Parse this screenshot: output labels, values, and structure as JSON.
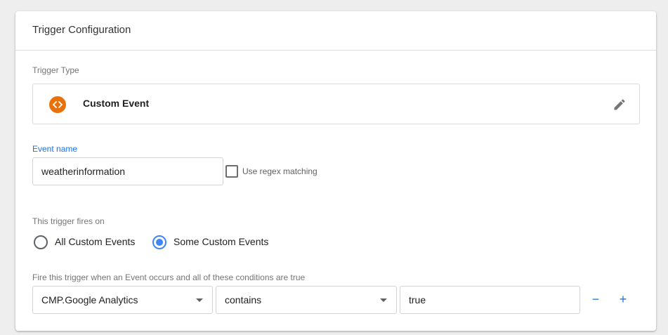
{
  "card": {
    "title": "Trigger Configuration"
  },
  "trigger_type": {
    "label": "Trigger Type",
    "name": "Custom Event",
    "icon": "code-brackets-icon",
    "icon_color": "#e8710a"
  },
  "event_name": {
    "label": "Event name",
    "value": "weatherinformation",
    "regex_label": "Use regex matching",
    "regex_checked": false
  },
  "fires_on": {
    "label": "This trigger fires on",
    "options": [
      {
        "label": "All Custom Events",
        "selected": false
      },
      {
        "label": "Some Custom Events",
        "selected": true
      }
    ]
  },
  "condition": {
    "label": "Fire this trigger when an Event occurs and all of these conditions are true",
    "variable": "CMP.Google Analytics",
    "operator": "contains",
    "value": "true",
    "remove_label": "−",
    "add_label": "+"
  },
  "colors": {
    "accent": "#1a73e8",
    "radio_selected": "#4285f4"
  }
}
